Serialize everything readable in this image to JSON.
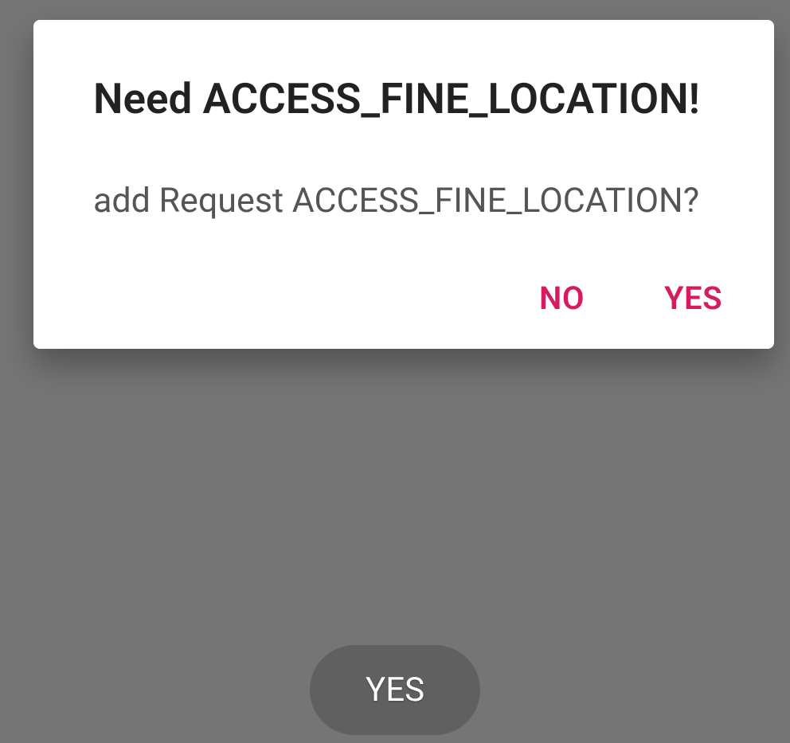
{
  "dialog": {
    "title": "Need ACCESS_FINE_LOCATION!",
    "message": "add Request ACCESS_FINE_LOCATION?",
    "negative_label": "NO",
    "positive_label": "YES"
  },
  "toast": {
    "text": "YES"
  },
  "colors": {
    "accent": "#d81b60",
    "background": "#757575",
    "dialog_bg": "#ffffff"
  }
}
